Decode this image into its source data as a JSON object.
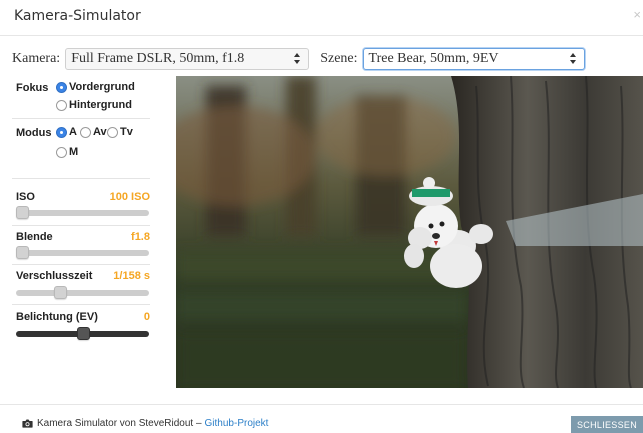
{
  "window": {
    "title": "Kamera-Simulator",
    "close_glyph": "×"
  },
  "selectors": {
    "kamera": {
      "label": "Kamera:",
      "value": "Full Frame DSLR, 50mm, f1.8"
    },
    "szene": {
      "label": "Szene:",
      "value": "Tree Bear, 50mm, 9EV"
    }
  },
  "fokus": {
    "label": "Fokus",
    "options": [
      {
        "label": "Vordergrund",
        "selected": true
      },
      {
        "label": "Hintergrund",
        "selected": false
      }
    ]
  },
  "modus": {
    "label": "Modus",
    "options": [
      {
        "label": "A",
        "selected": true
      },
      {
        "label": "Av",
        "selected": false
      },
      {
        "label": "Tv",
        "selected": false
      },
      {
        "label": "M",
        "selected": false
      }
    ]
  },
  "sliders": {
    "iso": {
      "label": "ISO",
      "value": "100 ISO",
      "level": 0.0
    },
    "blende": {
      "label": "Blende",
      "value": "f1.8",
      "level": 0.0
    },
    "verschlusszeit": {
      "label": "Verschlusszeit",
      "value": "1/158 s",
      "level": 0.31
    },
    "belichtung": {
      "label": "Belichtung (EV)",
      "value": "0",
      "level": 0.5
    }
  },
  "footer": {
    "icon": "camera-icon",
    "text": "Kamera Simulator von SteveRidout – ",
    "link": "Github-Projekt",
    "close_button": "SCHLIESSEN"
  },
  "colors": {
    "accent": "#f5a623",
    "link": "#2c7fc8",
    "radio_on": "#3b84e6",
    "close_button": "#7d9bad"
  }
}
